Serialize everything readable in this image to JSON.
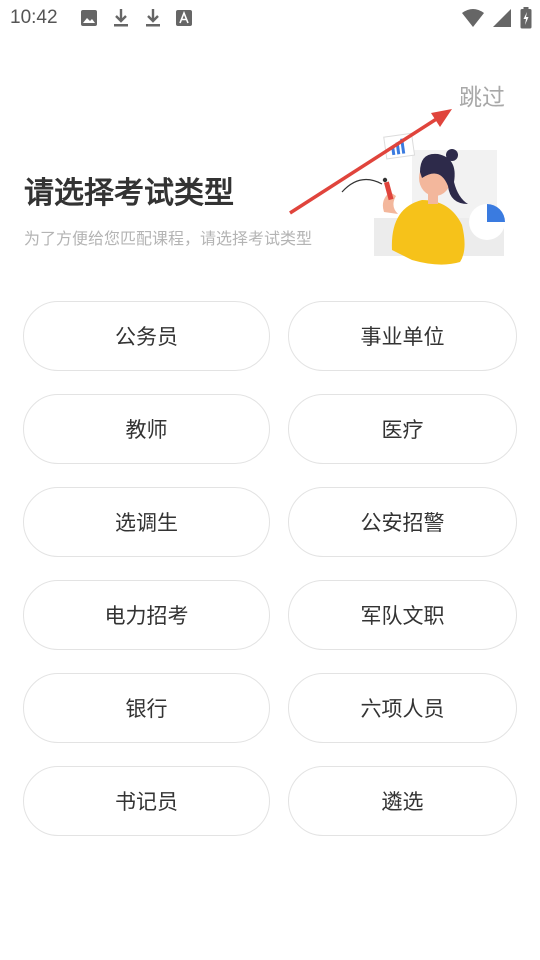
{
  "status_bar": {
    "time": "10:42",
    "icons_left": [
      "image-icon",
      "download-icon",
      "download-icon",
      "font-a-icon"
    ],
    "icons_right": [
      "wifi-icon",
      "signal-icon",
      "battery-charging-icon"
    ]
  },
  "skip_label": "跳过",
  "header": {
    "title": "请选择考试类型",
    "subtitle": "为了方便给您匹配课程，请选择考试类型"
  },
  "exam_types": [
    "公务员",
    "事业单位",
    "教师",
    "医疗",
    "选调生",
    "公安招警",
    "电力招考",
    "军队文职",
    "银行",
    "六项人员",
    "书记员",
    "遴选"
  ],
  "colors": {
    "accent_red": "#e0443c",
    "accent_yellow": "#f6c21a",
    "accent_blue": "#3a7be0",
    "text_dark": "#333333",
    "text_light": "#b4b4b4",
    "border": "#e3e3e3"
  }
}
